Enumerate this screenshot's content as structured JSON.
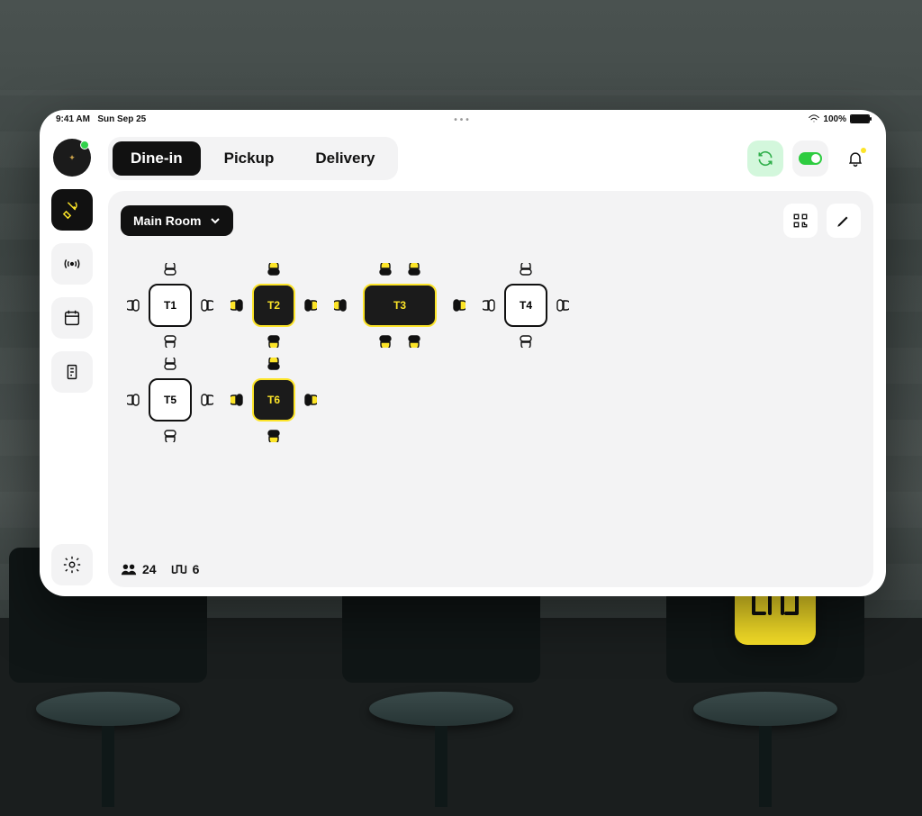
{
  "statusbar": {
    "time": "9:41 AM",
    "date": "Sun Sep 25",
    "battery_pct": "100%"
  },
  "tabs": {
    "dine_in": "Dine-in",
    "pickup": "Pickup",
    "delivery": "Delivery",
    "active": "dine_in"
  },
  "room_selector": {
    "selected": "Main Room"
  },
  "tables": [
    {
      "id": "t1",
      "label": "T1",
      "occupied": false,
      "wide": false,
      "row": 0,
      "col": 0
    },
    {
      "id": "t2",
      "label": "T2",
      "occupied": true,
      "wide": false,
      "row": 0,
      "col": 1
    },
    {
      "id": "t3",
      "label": "T3",
      "occupied": true,
      "wide": true,
      "row": 0,
      "col": 2
    },
    {
      "id": "t4",
      "label": "T4",
      "occupied": false,
      "wide": false,
      "row": 0,
      "col": 3
    },
    {
      "id": "t5",
      "label": "T5",
      "occupied": false,
      "wide": false,
      "row": 1,
      "col": 0
    },
    {
      "id": "t6",
      "label": "T6",
      "occupied": true,
      "wide": false,
      "row": 1,
      "col": 1
    }
  ],
  "footer": {
    "guests": "24",
    "tables": "6"
  },
  "icons": {
    "refresh": "refresh-icon",
    "toggle": "toggle-icon",
    "bell": "bell-icon",
    "qr": "qr-icon",
    "edit": "edit-icon",
    "nav_dine": "utensils-icon",
    "nav_signal": "signal-icon",
    "nav_calendar": "calendar-icon",
    "nav_receipt": "receipt-icon",
    "nav_settings": "gear-icon"
  },
  "colors": {
    "accent": "#fce428",
    "ink": "#111111",
    "panel": "#f3f3f4",
    "ok": "#2ecc40"
  }
}
